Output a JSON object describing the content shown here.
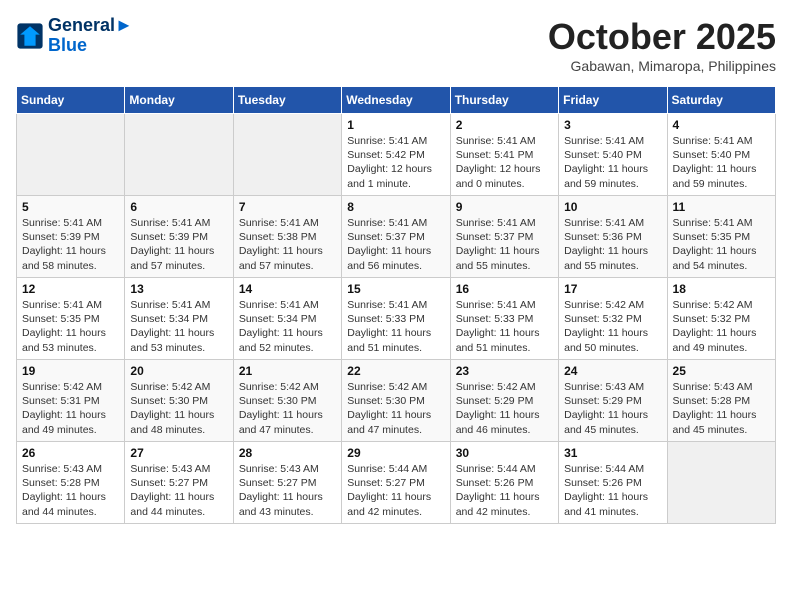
{
  "header": {
    "logo_line1": "General",
    "logo_line2": "Blue",
    "month": "October 2025",
    "location": "Gabawan, Mimaropa, Philippines"
  },
  "days_of_week": [
    "Sunday",
    "Monday",
    "Tuesday",
    "Wednesday",
    "Thursday",
    "Friday",
    "Saturday"
  ],
  "weeks": [
    [
      {
        "day": "",
        "info": ""
      },
      {
        "day": "",
        "info": ""
      },
      {
        "day": "",
        "info": ""
      },
      {
        "day": "1",
        "info": "Sunrise: 5:41 AM\nSunset: 5:42 PM\nDaylight: 12 hours\nand 1 minute."
      },
      {
        "day": "2",
        "info": "Sunrise: 5:41 AM\nSunset: 5:41 PM\nDaylight: 12 hours\nand 0 minutes."
      },
      {
        "day": "3",
        "info": "Sunrise: 5:41 AM\nSunset: 5:40 PM\nDaylight: 11 hours\nand 59 minutes."
      },
      {
        "day": "4",
        "info": "Sunrise: 5:41 AM\nSunset: 5:40 PM\nDaylight: 11 hours\nand 59 minutes."
      }
    ],
    [
      {
        "day": "5",
        "info": "Sunrise: 5:41 AM\nSunset: 5:39 PM\nDaylight: 11 hours\nand 58 minutes."
      },
      {
        "day": "6",
        "info": "Sunrise: 5:41 AM\nSunset: 5:39 PM\nDaylight: 11 hours\nand 57 minutes."
      },
      {
        "day": "7",
        "info": "Sunrise: 5:41 AM\nSunset: 5:38 PM\nDaylight: 11 hours\nand 57 minutes."
      },
      {
        "day": "8",
        "info": "Sunrise: 5:41 AM\nSunset: 5:37 PM\nDaylight: 11 hours\nand 56 minutes."
      },
      {
        "day": "9",
        "info": "Sunrise: 5:41 AM\nSunset: 5:37 PM\nDaylight: 11 hours\nand 55 minutes."
      },
      {
        "day": "10",
        "info": "Sunrise: 5:41 AM\nSunset: 5:36 PM\nDaylight: 11 hours\nand 55 minutes."
      },
      {
        "day": "11",
        "info": "Sunrise: 5:41 AM\nSunset: 5:35 PM\nDaylight: 11 hours\nand 54 minutes."
      }
    ],
    [
      {
        "day": "12",
        "info": "Sunrise: 5:41 AM\nSunset: 5:35 PM\nDaylight: 11 hours\nand 53 minutes."
      },
      {
        "day": "13",
        "info": "Sunrise: 5:41 AM\nSunset: 5:34 PM\nDaylight: 11 hours\nand 53 minutes."
      },
      {
        "day": "14",
        "info": "Sunrise: 5:41 AM\nSunset: 5:34 PM\nDaylight: 11 hours\nand 52 minutes."
      },
      {
        "day": "15",
        "info": "Sunrise: 5:41 AM\nSunset: 5:33 PM\nDaylight: 11 hours\nand 51 minutes."
      },
      {
        "day": "16",
        "info": "Sunrise: 5:41 AM\nSunset: 5:33 PM\nDaylight: 11 hours\nand 51 minutes."
      },
      {
        "day": "17",
        "info": "Sunrise: 5:42 AM\nSunset: 5:32 PM\nDaylight: 11 hours\nand 50 minutes."
      },
      {
        "day": "18",
        "info": "Sunrise: 5:42 AM\nSunset: 5:32 PM\nDaylight: 11 hours\nand 49 minutes."
      }
    ],
    [
      {
        "day": "19",
        "info": "Sunrise: 5:42 AM\nSunset: 5:31 PM\nDaylight: 11 hours\nand 49 minutes."
      },
      {
        "day": "20",
        "info": "Sunrise: 5:42 AM\nSunset: 5:30 PM\nDaylight: 11 hours\nand 48 minutes."
      },
      {
        "day": "21",
        "info": "Sunrise: 5:42 AM\nSunset: 5:30 PM\nDaylight: 11 hours\nand 47 minutes."
      },
      {
        "day": "22",
        "info": "Sunrise: 5:42 AM\nSunset: 5:30 PM\nDaylight: 11 hours\nand 47 minutes."
      },
      {
        "day": "23",
        "info": "Sunrise: 5:42 AM\nSunset: 5:29 PM\nDaylight: 11 hours\nand 46 minutes."
      },
      {
        "day": "24",
        "info": "Sunrise: 5:43 AM\nSunset: 5:29 PM\nDaylight: 11 hours\nand 45 minutes."
      },
      {
        "day": "25",
        "info": "Sunrise: 5:43 AM\nSunset: 5:28 PM\nDaylight: 11 hours\nand 45 minutes."
      }
    ],
    [
      {
        "day": "26",
        "info": "Sunrise: 5:43 AM\nSunset: 5:28 PM\nDaylight: 11 hours\nand 44 minutes."
      },
      {
        "day": "27",
        "info": "Sunrise: 5:43 AM\nSunset: 5:27 PM\nDaylight: 11 hours\nand 44 minutes."
      },
      {
        "day": "28",
        "info": "Sunrise: 5:43 AM\nSunset: 5:27 PM\nDaylight: 11 hours\nand 43 minutes."
      },
      {
        "day": "29",
        "info": "Sunrise: 5:44 AM\nSunset: 5:27 PM\nDaylight: 11 hours\nand 42 minutes."
      },
      {
        "day": "30",
        "info": "Sunrise: 5:44 AM\nSunset: 5:26 PM\nDaylight: 11 hours\nand 42 minutes."
      },
      {
        "day": "31",
        "info": "Sunrise: 5:44 AM\nSunset: 5:26 PM\nDaylight: 11 hours\nand 41 minutes."
      },
      {
        "day": "",
        "info": ""
      }
    ]
  ]
}
